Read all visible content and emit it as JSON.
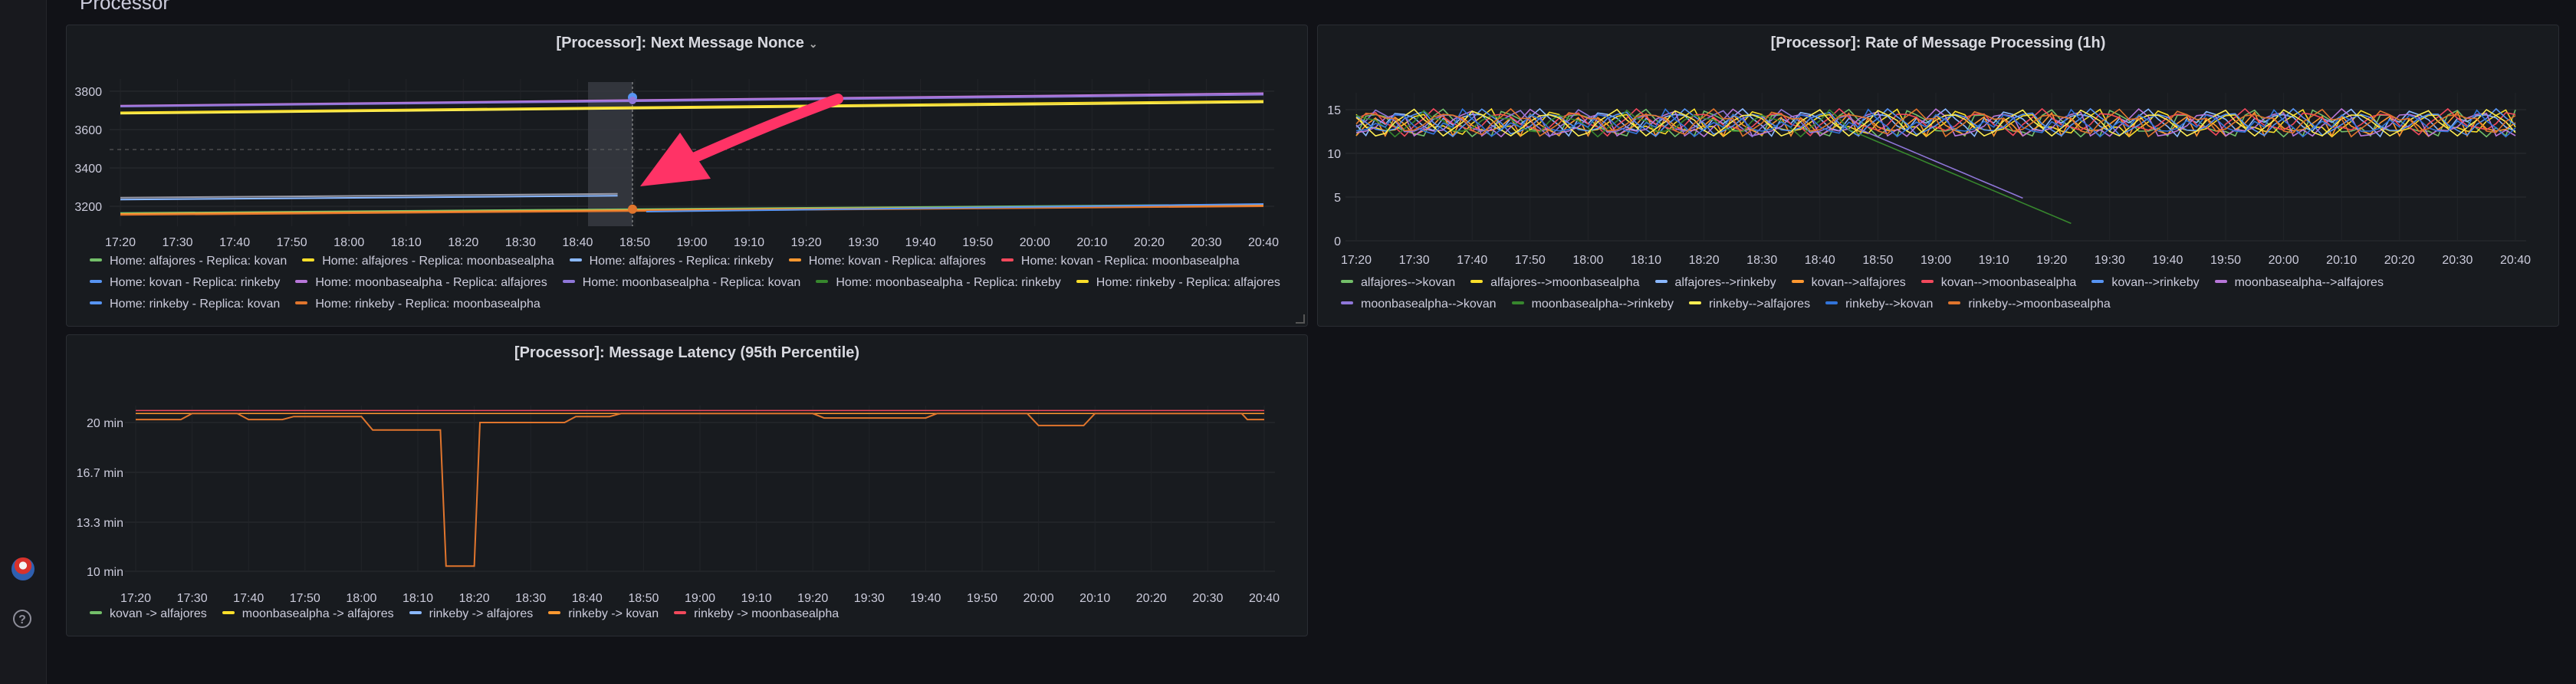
{
  "section": {
    "title": "Processor"
  },
  "sidebar": {
    "avatar_icon": "user-avatar-icon",
    "help_icon": "question-icon",
    "help_glyph": "?"
  },
  "colors": {
    "green": "#73bf69",
    "yellow": "#fade2a",
    "lightblue": "#8ab8ff",
    "orange": "#ff9830",
    "red": "#f2495c",
    "blue": "#5794f2",
    "purple": "#b877d9",
    "darkpurple": "#8f77d9",
    "darkgreen": "#37872d",
    "lightyellow": "#ffee52",
    "steelblue": "#3274d9",
    "darkorange": "#e0752d",
    "annotation": "#ff3366"
  },
  "panels": {
    "nonce": {
      "title": "[Processor]: Next Message Nonce",
      "y_ticks": [
        "3800",
        "3600",
        "3400",
        "3200"
      ],
      "x_ticks": [
        "17:20",
        "17:30",
        "17:40",
        "17:50",
        "18:00",
        "18:10",
        "18:20",
        "18:30",
        "18:40",
        "18:50",
        "19:00",
        "19:10",
        "19:20",
        "19:30",
        "19:40",
        "19:50",
        "20:00",
        "20:10",
        "20:20",
        "20:30",
        "20:40"
      ],
      "legend": [
        {
          "label": "Home: alfajores - Replica: kovan",
          "color": "#73bf69"
        },
        {
          "label": "Home: alfajores - Replica: moonbasealpha",
          "color": "#fade2a"
        },
        {
          "label": "Home: alfajores - Replica: rinkeby",
          "color": "#8ab8ff"
        },
        {
          "label": "Home: kovan - Replica: alfajores",
          "color": "#ff9830"
        },
        {
          "label": "Home: kovan - Replica: moonbasealpha",
          "color": "#f2495c"
        },
        {
          "label": "Home: kovan - Replica: rinkeby",
          "color": "#5794f2"
        },
        {
          "label": "Home: moonbasealpha - Replica: alfajores",
          "color": "#b877d9"
        },
        {
          "label": "Home: moonbasealpha - Replica: kovan",
          "color": "#8f77d9"
        },
        {
          "label": "Home: moonbasealpha - Replica: rinkeby",
          "color": "#37872d"
        },
        {
          "label": "Home: rinkeby - Replica: alfajores",
          "color": "#fade2a"
        },
        {
          "label": "Home: rinkeby - Replica: kovan",
          "color": "#5794f2"
        },
        {
          "label": "Home: rinkeby - Replica: moonbasealpha",
          "color": "#e0752d"
        }
      ]
    },
    "rate": {
      "title": "[Processor]: Rate of Message Processing (1h)",
      "y_ticks": [
        "15",
        "10",
        "5",
        "0"
      ],
      "x_ticks": [
        "17:20",
        "17:30",
        "17:40",
        "17:50",
        "18:00",
        "18:10",
        "18:20",
        "18:30",
        "18:40",
        "18:50",
        "19:00",
        "19:10",
        "19:20",
        "19:30",
        "19:40",
        "19:50",
        "20:00",
        "20:10",
        "20:20",
        "20:30",
        "20:40"
      ],
      "legend": [
        {
          "label": "alfajores-->kovan",
          "color": "#73bf69"
        },
        {
          "label": "alfajores-->moonbasealpha",
          "color": "#fade2a"
        },
        {
          "label": "alfajores-->rinkeby",
          "color": "#8ab8ff"
        },
        {
          "label": "kovan-->alfajores",
          "color": "#ff9830"
        },
        {
          "label": "kovan-->moonbasealpha",
          "color": "#f2495c"
        },
        {
          "label": "kovan-->rinkeby",
          "color": "#5794f2"
        },
        {
          "label": "moonbasealpha-->alfajores",
          "color": "#b877d9"
        },
        {
          "label": "moonbasealpha-->kovan",
          "color": "#8f77d9"
        },
        {
          "label": "moonbasealpha-->rinkeby",
          "color": "#37872d"
        },
        {
          "label": "rinkeby-->alfajores",
          "color": "#ffee52"
        },
        {
          "label": "rinkeby-->kovan",
          "color": "#3274d9"
        },
        {
          "label": "rinkeby-->moonbasealpha",
          "color": "#e0752d"
        }
      ]
    },
    "latency": {
      "title": "[Processor]: Message Latency (95th Percentile)",
      "y_ticks": [
        "20 min",
        "16.7 min",
        "13.3 min",
        "10 min"
      ],
      "x_ticks": [
        "17:20",
        "17:30",
        "17:40",
        "17:50",
        "18:00",
        "18:10",
        "18:20",
        "18:30",
        "18:40",
        "18:50",
        "19:00",
        "19:10",
        "19:20",
        "19:30",
        "19:40",
        "19:50",
        "20:00",
        "20:10",
        "20:20",
        "20:30",
        "20:40"
      ],
      "legend": [
        {
          "label": "kovan -> alfajores",
          "color": "#73bf69"
        },
        {
          "label": "moonbasealpha -> alfajores",
          "color": "#fade2a"
        },
        {
          "label": "rinkeby -> alfajores",
          "color": "#8ab8ff"
        },
        {
          "label": "rinkeby -> kovan",
          "color": "#ff9830"
        },
        {
          "label": "rinkeby -> moonbasealpha",
          "color": "#f2495c"
        }
      ]
    }
  }
}
